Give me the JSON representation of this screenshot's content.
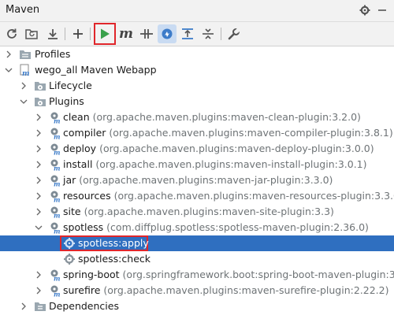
{
  "panel": {
    "title": "Maven"
  },
  "colors": {
    "selection": "#2f6fc0",
    "highlight_border": "#e0262b",
    "run_green": "#3aa04b",
    "plugin_gear": "#7d8a94"
  },
  "toolbar": {
    "buttons": [
      {
        "name": "reload-all-icon"
      },
      {
        "name": "generate-sources-icon"
      },
      {
        "name": "download-sources-icon"
      },
      {
        "name": "add-project-icon"
      },
      {
        "name": "run-icon"
      },
      {
        "name": "execute-goal-icon",
        "glyph": "m"
      },
      {
        "name": "toggle-offline-icon"
      },
      {
        "name": "skip-tests-icon"
      },
      {
        "name": "show-dependencies-icon"
      },
      {
        "name": "collapse-all-icon"
      },
      {
        "name": "settings-wrench-icon"
      }
    ]
  },
  "tree": {
    "profiles": "Profiles",
    "project": "wego_all Maven Webapp",
    "lifecycle": "Lifecycle",
    "plugins": "Plugins",
    "plugin_items": [
      {
        "name": "clean",
        "detail": "(org.apache.maven.plugins:maven-clean-plugin:3.2.0)"
      },
      {
        "name": "compiler",
        "detail": "(org.apache.maven.plugins:maven-compiler-plugin:3.8.1)"
      },
      {
        "name": "deploy",
        "detail": "(org.apache.maven.plugins:maven-deploy-plugin:3.0.0)"
      },
      {
        "name": "install",
        "detail": "(org.apache.maven.plugins:maven-install-plugin:3.0.1)"
      },
      {
        "name": "jar",
        "detail": "(org.apache.maven.plugins:maven-jar-plugin:3.3.0)"
      },
      {
        "name": "resources",
        "detail": "(org.apache.maven.plugins:maven-resources-plugin:3.3.0)"
      },
      {
        "name": "site",
        "detail": "(org.apache.maven.plugins:maven-site-plugin:3.3)"
      },
      {
        "name": "spotless",
        "detail": "(com.diffplug.spotless:spotless-maven-plugin:2.36.0)"
      }
    ],
    "goals": [
      "spotless:apply",
      "spotless:check"
    ],
    "more_plugins": [
      {
        "name": "spring-boot",
        "detail": "(org.springframework.boot:spring-boot-maven-plugin:3.0.2)"
      },
      {
        "name": "surefire",
        "detail": "(org.apache.maven.plugins:maven-surefire-plugin:2.22.2)"
      }
    ],
    "dependencies": "Dependencies"
  }
}
